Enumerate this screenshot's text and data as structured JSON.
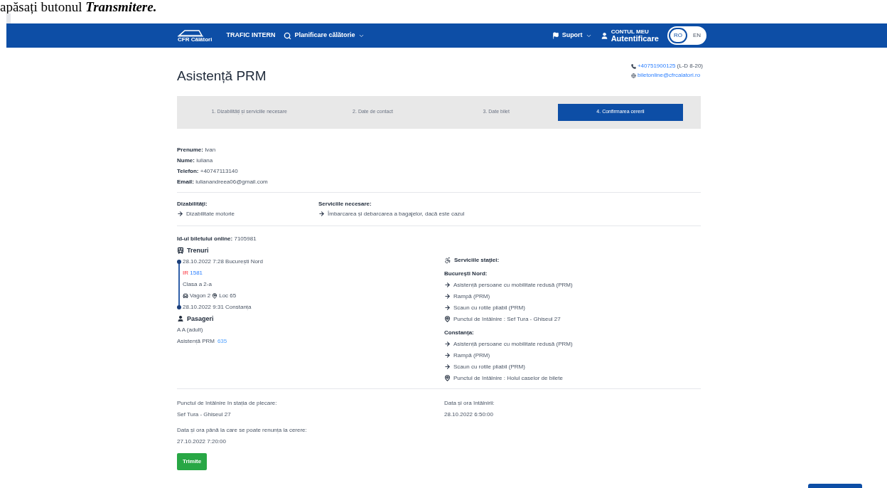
{
  "caption": {
    "lead": "apăsați butonul",
    "emphasis": "Transmitere."
  },
  "nav": {
    "logo": "CFR Călători",
    "links": [
      {
        "kind": "plain",
        "label": "TRAFIC INTERN"
      },
      {
        "kind": "search",
        "label": "Planificare călătorie"
      }
    ],
    "support": "Suport",
    "account": {
      "small": "CONTUL MEU",
      "label": "Autentificare"
    },
    "languages": [
      {
        "label": "RO",
        "selected": true
      },
      {
        "label": "EN",
        "selected": false
      }
    ]
  },
  "page_title": "Asistență PRM",
  "contact": {
    "phone": "+40751900125",
    "hours": "(L-D 8-20)",
    "email": "biletonline@cfrcalatori.ro"
  },
  "steps": [
    {
      "label": "1. Dizabilități și serviciile necesare",
      "selected": false
    },
    {
      "label": "2. Date de contact",
      "selected": false
    },
    {
      "label": "3. Date bilet",
      "selected": false
    },
    {
      "label": "4. Confirmarea cererii",
      "selected": true
    }
  ],
  "person": [
    {
      "label": "Prenume:",
      "value": "Ivan"
    },
    {
      "label": "Nume:",
      "value": "iuliana"
    },
    {
      "label": "Telefon:",
      "value": "+40747113140"
    },
    {
      "label": "Email:",
      "value": "iulianandreea06@gmail.com"
    }
  ],
  "disabilities": {
    "title": "Dizabilități:",
    "items": [
      "Dizabilitate motorie"
    ]
  },
  "services": {
    "title": "Serviciile necesare:",
    "items": [
      "Îmbarcarea și debarcarea a bagajelor, dacă este cazul"
    ]
  },
  "ticket": {
    "id_label": "Id-ul biletului online:",
    "id": "7105981",
    "trains_title": "Trenuri",
    "departure": "28.10.2022 7:28 București Nord",
    "train_type": "IR",
    "train_number": "1581",
    "class": "Clasa a 2-a",
    "wagon": "Vagon 2",
    "seat": "Loc 65",
    "arrival": "28.10.2022 9:31 Constanța",
    "passengers_title": "Pasageri",
    "passengers": [
      "A A (adult)"
    ],
    "assistance": "Asistență PRM",
    "assistance_link": "635"
  },
  "station_services": {
    "title": "Serviciile stației:",
    "stations": [
      {
        "name": "București Nord:",
        "items": [
          {
            "kind": "service",
            "text": "Asistență persoane cu mobilitate redusă (PRM)"
          },
          {
            "kind": "service",
            "text": "Rampă (PRM)"
          },
          {
            "kind": "service",
            "text": "Scaun cu rotile pliabil (PRM)"
          },
          {
            "kind": "meeting",
            "text": "Punctul de întâlnire : Sef Tura - Ghiseul 27"
          }
        ]
      },
      {
        "name": "Constanța:",
        "items": [
          {
            "kind": "service",
            "text": "Asistență persoane cu mobilitate redusă (PRM)"
          },
          {
            "kind": "service",
            "text": "Rampă (PRM)"
          },
          {
            "kind": "service",
            "text": "Scaun cu rotile pliabil (PRM)"
          },
          {
            "kind": "meeting",
            "text": "Punctul de întâlnire : Holul caselor de bilete"
          }
        ]
      }
    ]
  },
  "summary": [
    {
      "label": "Punctul de întâlnire în stația de plecare:",
      "value": "Sef Tura - Ghiseul 27"
    },
    {
      "label": "Data și ora întâlnirii:",
      "value": "28.10.2022 6:50:00"
    },
    {
      "label": "Data și ora până la care se poate renunța la cerere:",
      "value": "27.10.2022 7:20:00"
    }
  ],
  "submit": "Trimite"
}
